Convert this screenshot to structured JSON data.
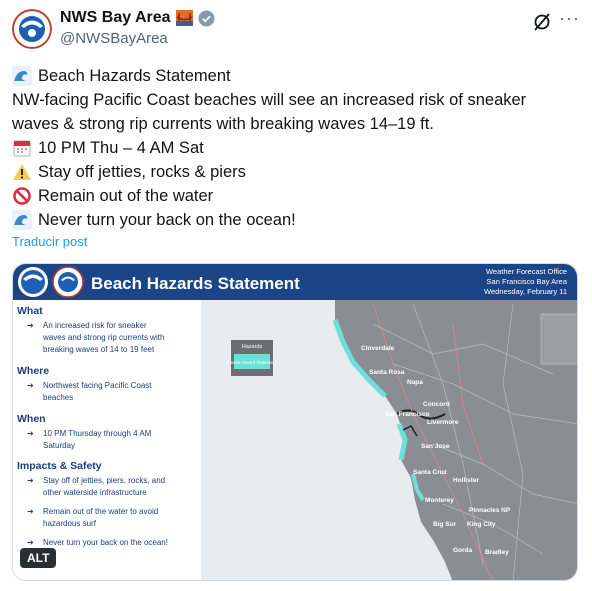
{
  "author": {
    "name": "NWS Bay Area",
    "handle": "@NWSBayArea"
  },
  "menu": {
    "more": "···"
  },
  "tweet": {
    "lines": [
      {
        "icon": "wave-icon",
        "text": "Beach Hazards Statement"
      },
      {
        "icon": "",
        "text": "NW-facing Pacific Coast beaches will see an increased risk of sneaker"
      },
      {
        "icon": "",
        "text": "waves & strong rip currents with breaking waves 14–19 ft."
      },
      {
        "icon": "calendar-icon",
        "text": "10 PM Thu – 4 AM Sat"
      },
      {
        "icon": "warning-icon",
        "text": "Stay off jetties, rocks & piers"
      },
      {
        "icon": "prohibited-icon",
        "text": "Remain out of the water"
      },
      {
        "icon": "wave-icon",
        "text": "Never turn your back on the ocean!"
      }
    ],
    "translate": "Traducir post"
  },
  "graphic": {
    "title": "Beach Hazards Statement",
    "office_lines": [
      "Weather Forecast Office",
      "San Francisco Bay Area",
      "Wednesday, February 11"
    ],
    "sections": [
      {
        "heading": "What",
        "items": [
          [
            "An increased risk for sneaker",
            "waves and strong rip currents with",
            "breaking waves of 14 to 19 feet"
          ]
        ]
      },
      {
        "heading": "Where",
        "items": [
          [
            "Northwest facing Pacific Coast",
            "beaches"
          ]
        ]
      },
      {
        "heading": "When",
        "items": [
          [
            "10 PM Thursday through 4 AM",
            "Saturday"
          ]
        ]
      },
      {
        "heading": "Impacts & Safety",
        "items": [
          [
            "Stay off of jetties, piers, rocks, and",
            "other waterside infrastructure"
          ],
          [
            "Remain out of the water to avoid",
            "hazardous surf"
          ],
          [
            "Never turn your back on the ocean!"
          ]
        ]
      }
    ],
    "legend": {
      "title": "Hazards",
      "item": "Beach Hazard Statement",
      "color": "#6ee0d6"
    },
    "cities": [
      "Cloverdale",
      "Santa Rosa",
      "Napa",
      "Concord",
      "San Francisco",
      "Livermore",
      "San Jose",
      "Santa Cruz",
      "Hollister",
      "Monterey",
      "Pinnacles NP",
      "King City",
      "Big Sur",
      "Gorda",
      "Bradley"
    ],
    "colors": {
      "header": "#1c4587",
      "land": "#8a8e94",
      "ocean": "#e8ebef",
      "hazard": "#6ee0d6"
    }
  },
  "alt_badge": "ALT"
}
